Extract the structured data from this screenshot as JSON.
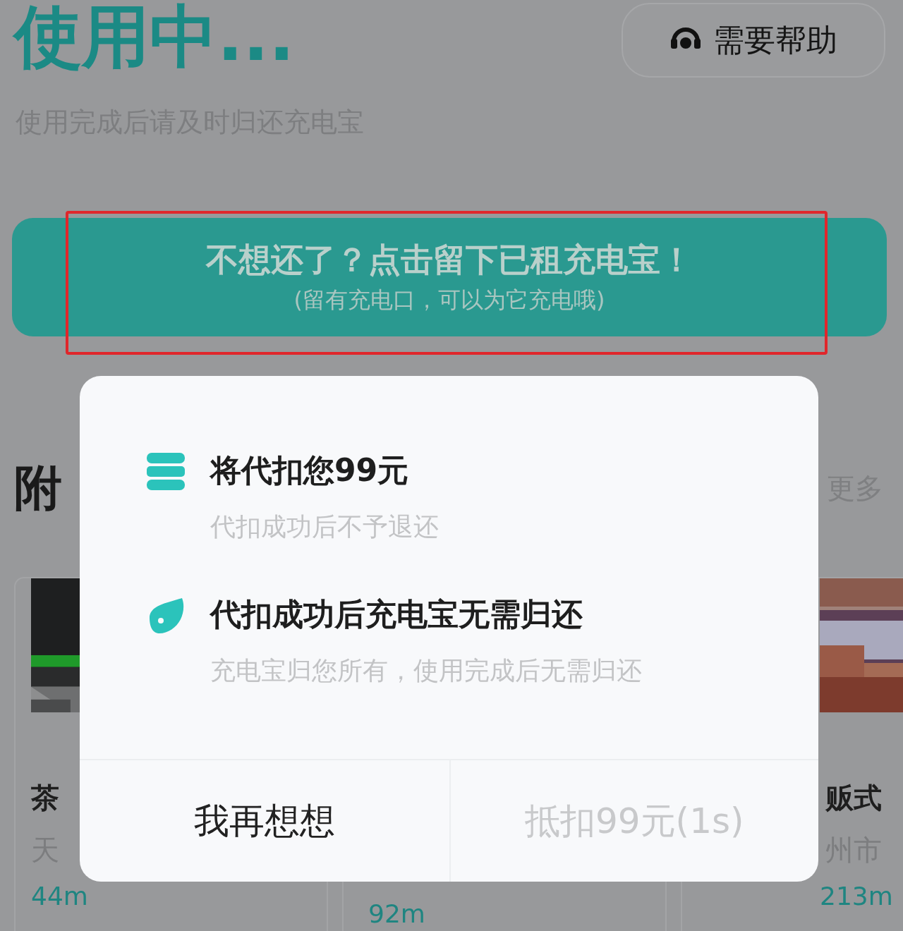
{
  "header": {
    "title": "使用中...",
    "help_button": "需要帮助",
    "subtitle": "使用完成后请及时归还充电宝"
  },
  "keep_banner": {
    "title": "不想还了？点击留下已租充电宝！",
    "note": "(留有充电口，可以为它充电哦)",
    "highlighted": true
  },
  "nearby": {
    "title": "附",
    "more": "更多",
    "cards": [
      {
        "name": "茶",
        "address": "天",
        "distance": "44m"
      },
      {
        "distance": "92m"
      },
      {
        "name": "贩式",
        "address": "州市",
        "distance": "213m"
      }
    ]
  },
  "dialog": {
    "items": [
      {
        "kind": "coins",
        "title": "将代扣您99元",
        "note": "代扣成功后不予退还"
      },
      {
        "kind": "charger",
        "title": "代扣成功后充电宝无需归还",
        "note": "充电宝归您所有，使用完成后无需归还"
      }
    ],
    "buttons": [
      {
        "label": "我再想想",
        "disabled": false
      },
      {
        "label": "抵扣99元(1s)",
        "disabled": true
      }
    ]
  }
}
